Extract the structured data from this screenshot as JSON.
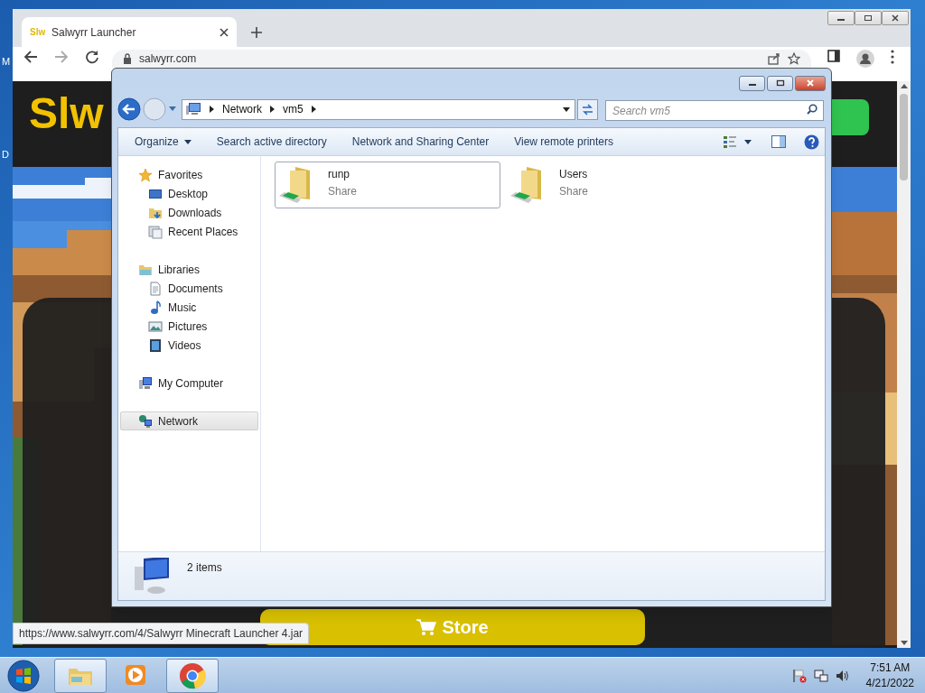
{
  "desktop_labels": [
    "M",
    "D"
  ],
  "browser": {
    "tab": {
      "logo": "Slw",
      "title": "Salwyrr Launcher"
    },
    "url": "salwyrr.com",
    "page": {
      "logo": "Slw",
      "store_button": "Store"
    },
    "status_url": "https://www.salwyrr.com/4/Salwyrr Minecraft Launcher 4.jar"
  },
  "explorer": {
    "breadcrumbs": [
      "Network",
      "vm5"
    ],
    "search": {
      "placeholder": "Search vm5"
    },
    "commands": [
      {
        "label": "Organize",
        "dropdown": true
      },
      {
        "label": "Search active directory",
        "dropdown": false
      },
      {
        "label": "Network and Sharing Center",
        "dropdown": false
      },
      {
        "label": "View remote printers",
        "dropdown": false
      }
    ],
    "nav": [
      {
        "label": "Favorites",
        "kind": "star",
        "selected": false,
        "children": [
          {
            "label": "Desktop",
            "kind": "desktop",
            "selected": false
          },
          {
            "label": "Downloads",
            "kind": "downloads",
            "selected": false
          },
          {
            "label": "Recent Places",
            "kind": "recent",
            "selected": false
          }
        ]
      },
      {
        "label": "Libraries",
        "kind": "library",
        "selected": false,
        "children": [
          {
            "label": "Documents",
            "kind": "documents",
            "selected": false
          },
          {
            "label": "Music",
            "kind": "music",
            "selected": false
          },
          {
            "label": "Pictures",
            "kind": "pictures",
            "selected": false
          },
          {
            "label": "Videos",
            "kind": "videos",
            "selected": false
          }
        ]
      },
      {
        "label": "My Computer",
        "kind": "computer",
        "selected": false
      },
      {
        "label": "Network",
        "kind": "network",
        "selected": true
      }
    ],
    "items": [
      {
        "name": "runp",
        "type": "Share",
        "selected": true
      },
      {
        "name": "Users",
        "type": "Share",
        "selected": false
      }
    ],
    "status": "2 items"
  },
  "taskbar": {
    "apps": [
      {
        "kind": "explorer",
        "selected": true
      },
      {
        "kind": "media",
        "selected": false
      },
      {
        "kind": "chrome",
        "selected": true
      }
    ],
    "time": "7:51 AM",
    "date": "4/21/2022"
  }
}
